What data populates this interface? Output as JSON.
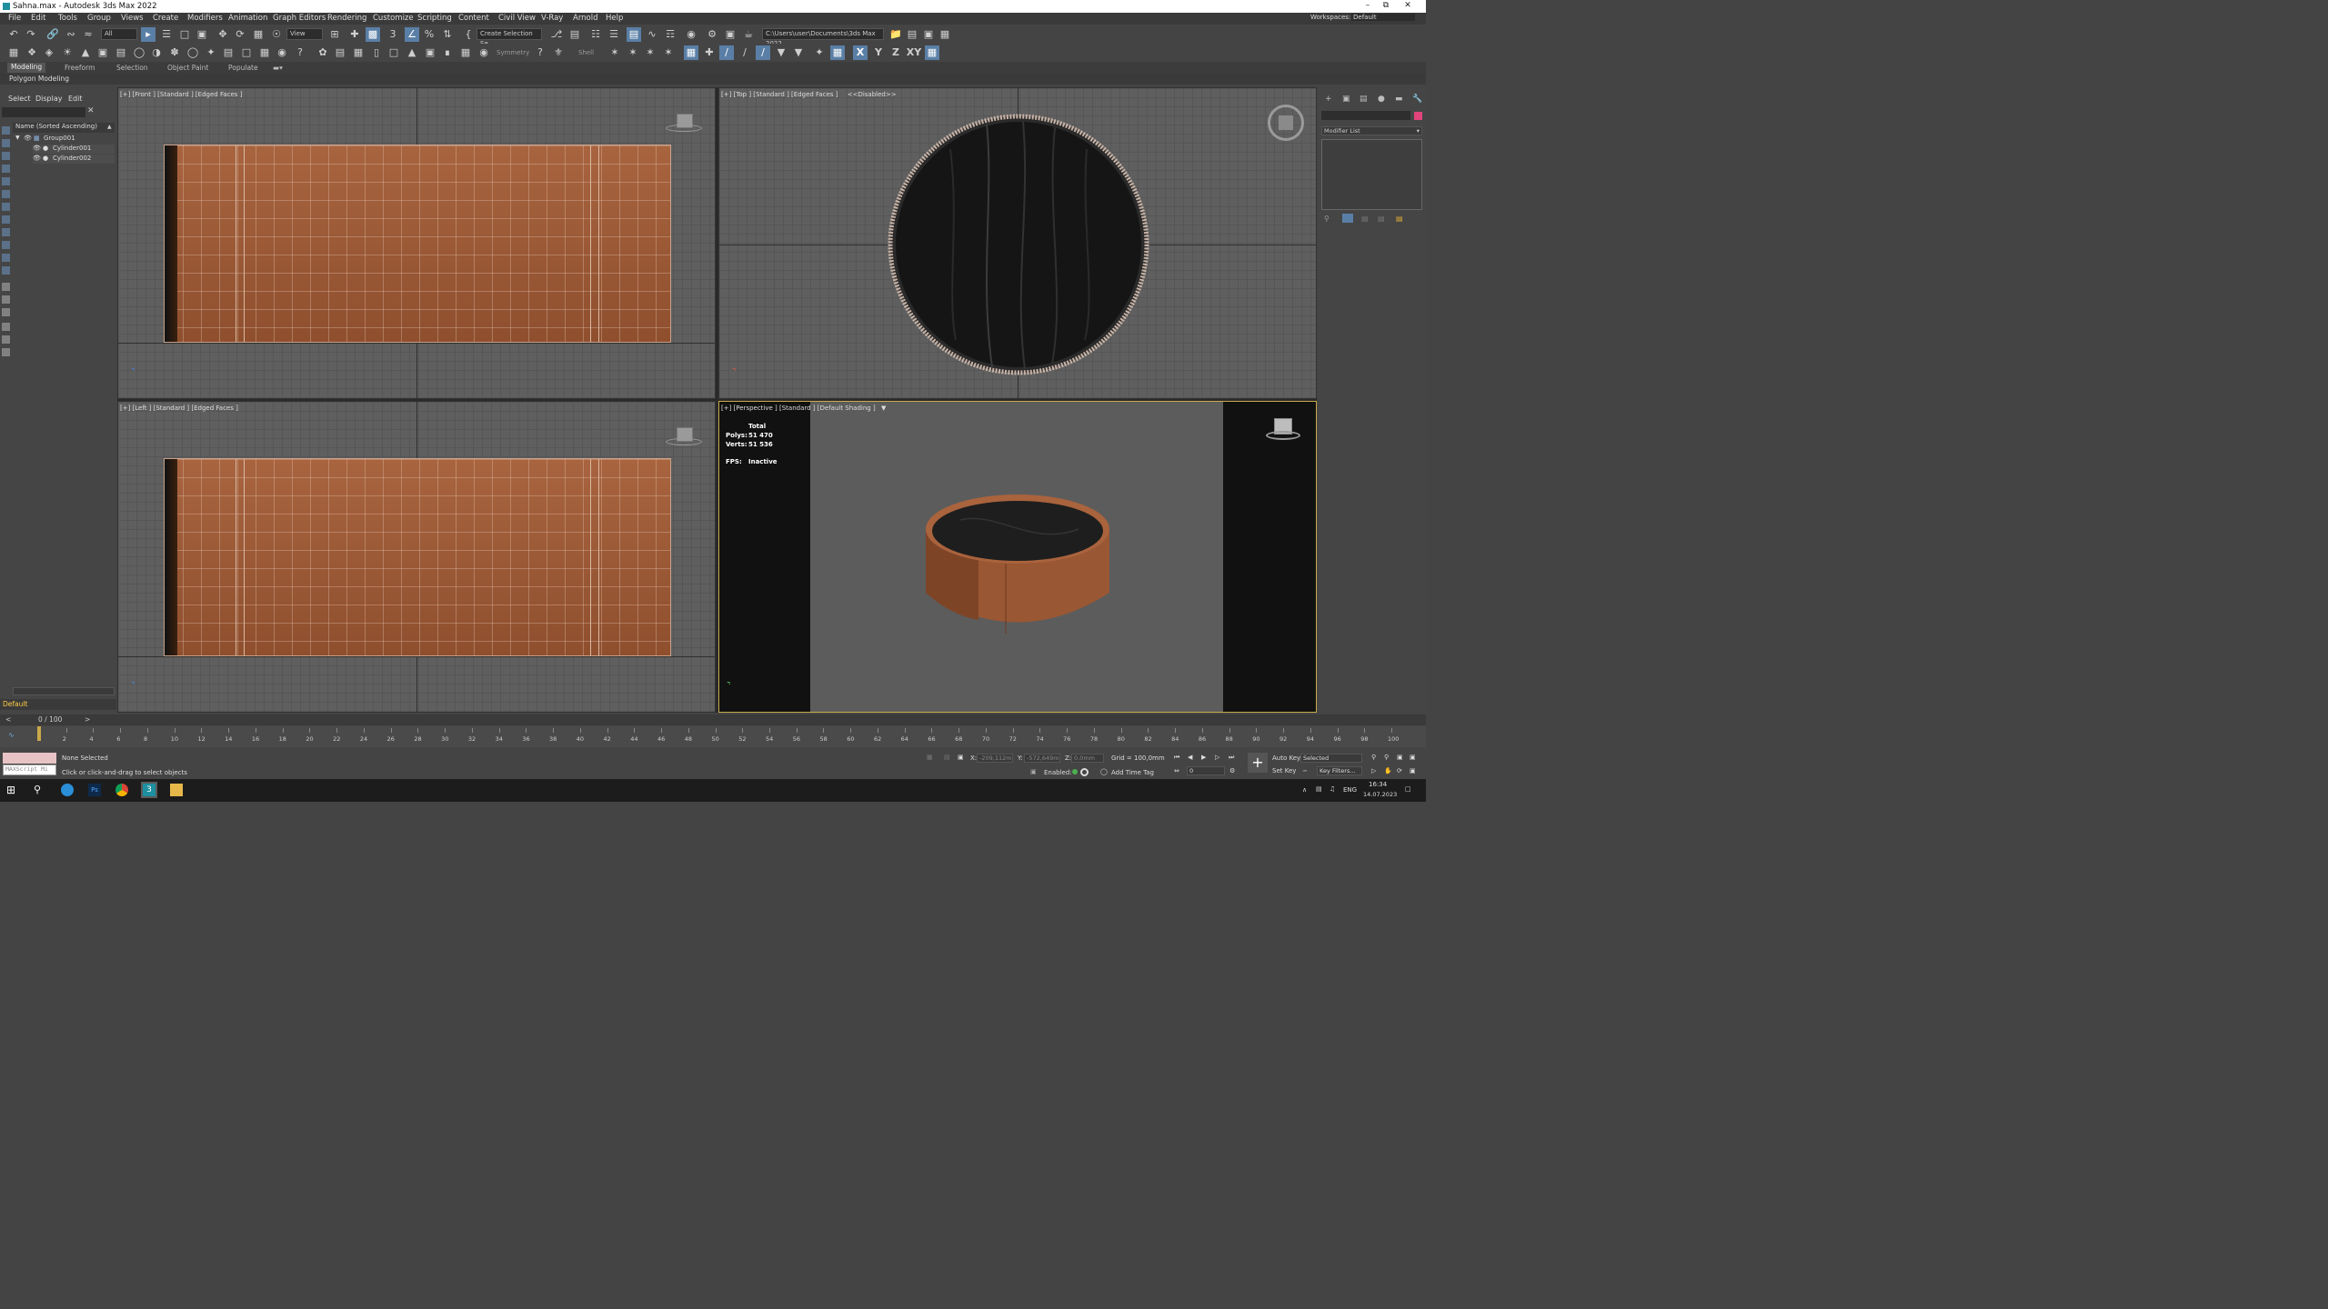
{
  "window": {
    "title": "Sahna.max - Autodesk 3ds Max 2022"
  },
  "menu": [
    "File",
    "Edit",
    "Tools",
    "Group",
    "Views",
    "Create",
    "Modifiers",
    "Animation",
    "Graph Editors",
    "Rendering",
    "Customize",
    "Scripting",
    "Content",
    "Civil View",
    "V-Ray",
    "Arnold",
    "Help"
  ],
  "workspace": {
    "label": "Workspaces:",
    "value": "Default"
  },
  "toolbar": {
    "filter": "All",
    "refcoord": "View",
    "selection_set": "Create Selection Se",
    "project_path": "C:\\Users\\user\\Documents\\3ds Max 2022",
    "symmetry": "Symmetry",
    "shell": "Shell",
    "axis_x": "X",
    "axis_y": "Y",
    "axis_z": "Z",
    "axis_xy": "XY"
  },
  "ribbon": {
    "tabs": [
      "Modeling",
      "Freeform",
      "Selection",
      "Object Paint",
      "Populate"
    ],
    "active": "Modeling",
    "panel": "Polygon Modeling"
  },
  "scene_explorer": {
    "tabs": [
      "Select",
      "Display",
      "Edit"
    ],
    "column_header": "Name (Sorted Ascending)",
    "tree": [
      {
        "label": "Group001",
        "level": 0
      },
      {
        "label": "Cylinder001",
        "level": 1
      },
      {
        "label": "Cylinder002",
        "level": 1
      }
    ],
    "layer": "Default"
  },
  "viewports": {
    "front": {
      "label": "[+] [Front ] [Standard ] [Edged Faces ]"
    },
    "top": {
      "label": "[+] [Top ] [Standard ] [Edged Faces ]",
      "disabled": "<<Disabled>>"
    },
    "left": {
      "label": "[+] [Left ] [Standard ] [Edged Faces ]"
    },
    "perspective": {
      "label": "[+] [Perspective ] [Standard ] [Default Shading ]"
    }
  },
  "stats": {
    "total_label": "Total",
    "polys_label": "Polys:",
    "polys": "51 470",
    "verts_label": "Verts:",
    "verts": "51 536",
    "fps_label": "FPS:",
    "fps": "Inactive"
  },
  "command_panel": {
    "modifier_list": "Modifier List",
    "swatch_color": "#e0447a"
  },
  "timeline": {
    "frame_display": "0 / 100",
    "ticks": [
      "0",
      "2",
      "4",
      "6",
      "8",
      "10",
      "12",
      "14",
      "16",
      "18",
      "20",
      "22",
      "24",
      "26",
      "28",
      "30",
      "32",
      "34",
      "36",
      "38",
      "40",
      "42",
      "44",
      "46",
      "48",
      "50",
      "52",
      "54",
      "56",
      "58",
      "60",
      "62",
      "64",
      "66",
      "68",
      "70",
      "72",
      "74",
      "76",
      "78",
      "80",
      "82",
      "84",
      "86",
      "88",
      "90",
      "92",
      "94",
      "96",
      "98",
      "100"
    ]
  },
  "status": {
    "maxscript": "MAXScript Mi",
    "selection": "None Selected",
    "prompt": "Click or click-and-drag to select objects",
    "x_label": "X:",
    "x_value": "-209,112m",
    "y_label": "Y:",
    "y_value": "-572,649m",
    "z_label": "Z:",
    "z_value": "0,0mm",
    "grid": "Grid = 100,0mm",
    "enabled": "Enabled:",
    "add_time_tag": "Add Time Tag",
    "auto_key": "Auto Key",
    "set_key": "Set Key",
    "key_mode": "Selected",
    "key_filters": "Key Filters...",
    "frame": "0"
  },
  "taskbar": {
    "lang": "ENG",
    "time": "16:34",
    "date": "14.07.2023"
  },
  "colors": {
    "accent_active_viewport": "#c9a94a",
    "leather": "#9a5733",
    "wood": "#1c1c1c",
    "toolbar_highlight": "#5a7fa6"
  }
}
